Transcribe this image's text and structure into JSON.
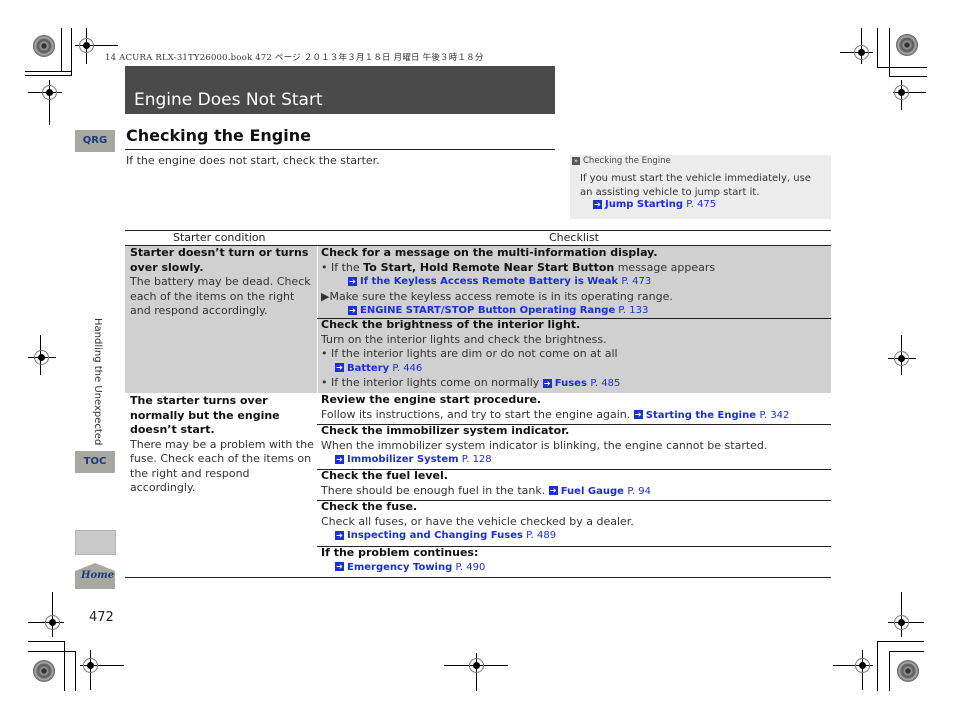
{
  "print_header": "14 ACURA RLX-31TY26000.book  472 ページ  ２０１３年３月１８日  月曜日  午後３時１８分",
  "chapter_title": "Engine Does Not Start",
  "section_title": "Checking the Engine",
  "intro": "If the engine does not start, check the starter.",
  "sidenote": {
    "header": "Checking the Engine",
    "body": "If you must start the vehicle immediately, use an assisting vehicle to jump start it.",
    "link": {
      "label": "Jump Starting",
      "page": "P. 475"
    }
  },
  "nav": {
    "qrg": "QRG",
    "toc": "TOC",
    "home": "Home",
    "chapter_tab": "Handling the Unexpected",
    "page_number": "472"
  },
  "table": {
    "headers": [
      "Starter condition",
      "Checklist"
    ],
    "conditions": [
      {
        "title": "Starter doesn’t turn or turns over slowly.",
        "text": "The battery may be dead. Check each of the items on the right and respond accordingly."
      },
      {
        "title": "The starter turns over normally but the engine doesn’t start.",
        "text": "There may be a problem with the fuse. Check each of the items on the right and respond accordingly."
      }
    ],
    "checks": [
      {
        "heading": "Check for a message on the multi-information display.",
        "bullet_prefix": "If the ",
        "bullet_bold": "To Start, Hold Remote Near Start Button",
        "bullet_suffix": " message appears",
        "link1": {
          "label": "If the Keyless Access Remote Battery is Weak",
          "page": "P. 473"
        },
        "note": "Make sure the keyless access remote is in its operating range.",
        "link2": {
          "label": "ENGINE START/STOP Button Operating Range",
          "page": "P. 133"
        }
      },
      {
        "heading": "Check the brightness of the interior light.",
        "text": "Turn on the interior lights and check the brightness.",
        "bullet1": "If the interior lights are dim or do not come on at all",
        "link1": {
          "label": "Battery",
          "page": "P. 446"
        },
        "bullet2": "If the interior lights come on normally",
        "link2": {
          "label": "Fuses",
          "page": "P. 485"
        }
      },
      {
        "heading": "Review the engine start procedure.",
        "text": "Follow its instructions, and try to start the engine again.",
        "link": {
          "label": "Starting the Engine",
          "page": "P. 342"
        }
      },
      {
        "heading": "Check the immobilizer system indicator.",
        "text": "When the immobilizer system indicator is blinking, the engine cannot be started.",
        "link": {
          "label": "Immobilizer System",
          "page": "P. 128"
        }
      },
      {
        "heading": "Check the fuel level.",
        "text": "There should be enough fuel in the tank.",
        "link": {
          "label": "Fuel Gauge",
          "page": "P. 94"
        }
      },
      {
        "heading": "Check the fuse.",
        "text": "Check all fuses, or have the vehicle checked by a dealer.",
        "link": {
          "label": "Inspecting and Changing Fuses",
          "page": "P. 489"
        }
      },
      {
        "heading": "If the problem continues:",
        "link": {
          "label": "Emergency Towing",
          "page": "P. 490"
        }
      }
    ]
  },
  "colors": {
    "title_bar": "#4a4a4a",
    "link_blue": "#1a2fd6",
    "nav_gray": "#a8a8a3",
    "nav_text": "#1a3a7a",
    "row_highlight": "#d0d0d0",
    "sidenote_bg": "#ececec"
  }
}
